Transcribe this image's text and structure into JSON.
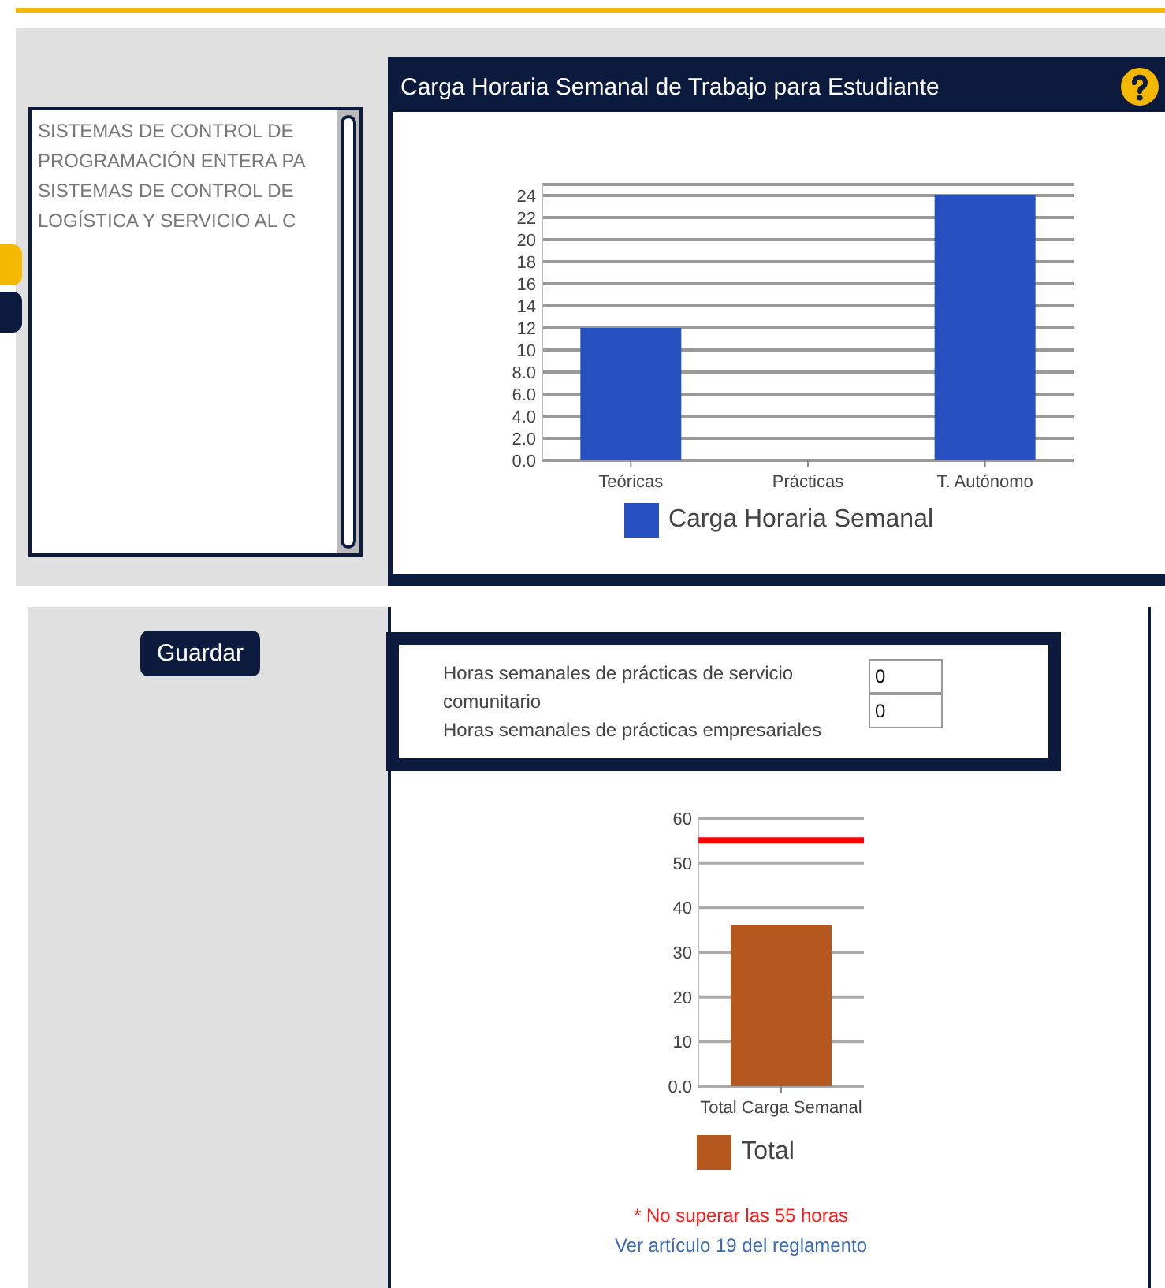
{
  "side_tabs": [
    {
      "color": "#f5b800"
    },
    {
      "color": "#0b1a3d"
    }
  ],
  "subjects": {
    "items": [
      {
        "label": "SISTEMAS DE CONTROL DE"
      },
      {
        "label": "PROGRAMACIÓN ENTERA PA"
      },
      {
        "label": "SISTEMAS DE CONTROL DE"
      },
      {
        "label": "LOGÍSTICA Y SERVICIO AL C"
      }
    ]
  },
  "workload_panel": {
    "title": "Carga Horaria Semanal de Trabajo para Estudiante",
    "chart_data": {
      "type": "bar",
      "categories": [
        "Teóricas",
        "Prácticas",
        "T. Autónomo"
      ],
      "series": [
        {
          "name": "Carga Horaria Semanal",
          "color": "#2650bf",
          "values": [
            12,
            0,
            24
          ]
        }
      ],
      "ylim": [
        0,
        25
      ],
      "grid": true,
      "yticks": [
        {
          "value": 0,
          "label": "0.0"
        },
        {
          "value": 2,
          "label": "2.0"
        },
        {
          "value": 4,
          "label": "4.0"
        },
        {
          "value": 6,
          "label": "6.0"
        },
        {
          "value": 8,
          "label": "8.0"
        },
        10,
        12,
        14,
        16,
        18,
        20,
        22,
        24
      ]
    }
  },
  "save_button": "Guardar",
  "practice_hours": [
    {
      "label": "Horas semanales de prácticas de servicio comunitario",
      "value": "0"
    },
    {
      "label": "Horas semanales de prácticas empresariales",
      "value": "0"
    }
  ],
  "total_chart": {
    "chart_data": {
      "type": "bar",
      "categories": [
        "Total Carga Semanal"
      ],
      "series": [
        {
          "name": "Total",
          "color": "#b5581f",
          "values": [
            36
          ]
        }
      ],
      "ylim": [
        0,
        60
      ],
      "grid": true,
      "yticks": [
        {
          "value": 0,
          "label": "0.0"
        },
        10,
        20,
        30,
        40,
        50,
        60
      ],
      "ref_lines": [
        {
          "axis": "y",
          "value": 55,
          "color": "#ff0000"
        }
      ]
    }
  },
  "warning": "* No superar las 55 horas",
  "rule_link": "Ver artículo 19 del reglamento"
}
